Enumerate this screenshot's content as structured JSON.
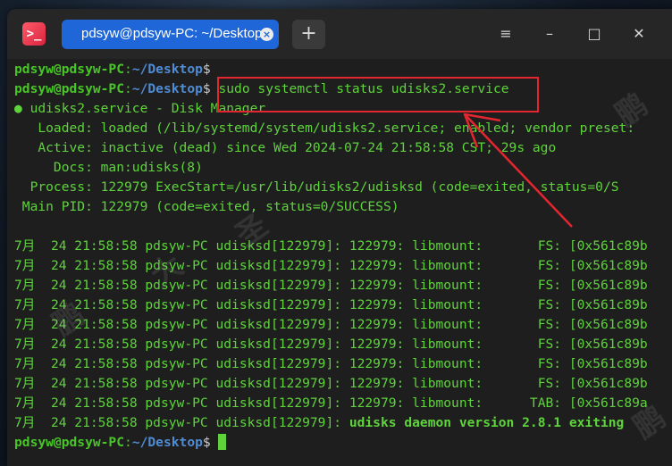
{
  "window": {
    "tab_title": "pdsyw@pdsyw-PC: ~/Desktop",
    "new_tab_symbol": "+",
    "tab_close_symbol": "×",
    "minimize_symbol": "–",
    "maximize_symbol": "□",
    "close_symbol": "✕",
    "menu_symbol": "≡",
    "app_icon_glyph": ">_"
  },
  "prompt": {
    "user": "pdsyw@pdsyw-PC",
    "sep": ":",
    "path": "~/Desktop",
    "dollar": "$"
  },
  "command": "sudo systemctl status udisks2.service",
  "status": {
    "l1": "● udisks2.service - Disk Manager",
    "l2": "   Loaded: loaded (/lib/systemd/system/udisks2.service; enabled; vendor preset:",
    "l3": "   Active: inactive (dead) since Wed 2024-07-24 21:58:58 CST; 29s ago",
    "l4": "     Docs: man:udisks(8)",
    "l5": "  Process: 122979 ExecStart=/usr/lib/udisks2/udisksd (code=exited, status=0/S",
    "l6": " Main PID: 122979 (code=exited, status=0/SUCCESS)"
  },
  "logs": [
    "7月  24 21:58:58 pdsyw-PC udisksd[122979]: 122979: libmount:       FS: [0x561c89b",
    "7月  24 21:58:58 pdsyw-PC udisksd[122979]: 122979: libmount:       FS: [0x561c89b",
    "7月  24 21:58:58 pdsyw-PC udisksd[122979]: 122979: libmount:       FS: [0x561c89b",
    "7月  24 21:58:58 pdsyw-PC udisksd[122979]: 122979: libmount:       FS: [0x561c89b",
    "7月  24 21:58:58 pdsyw-PC udisksd[122979]: 122979: libmount:       FS: [0x561c89b",
    "7月  24 21:58:58 pdsyw-PC udisksd[122979]: 122979: libmount:       FS: [0x561c89b",
    "7月  24 21:58:58 pdsyw-PC udisksd[122979]: 122979: libmount:       FS: [0x561c89b",
    "7月  24 21:58:58 pdsyw-PC udisksd[122979]: 122979: libmount:       FS: [0x561c89b",
    "7月  24 21:58:58 pdsyw-PC udisksd[122979]: 122979: libmount:      TAB: [0x561c89a"
  ],
  "last_log": {
    "prefix": "7月  24 21:58:58 pdsyw-PC udisksd[122979]: ",
    "message": "udisks daemon version 2.8.1 exiting"
  },
  "watermark": [
    "鹏",
    "大",
    "圣"
  ],
  "colors": {
    "terminal_bg": "#1e1e1e",
    "text_green": "#5fd33c",
    "path_blue": "#4f8cd6",
    "tab_blue": "#1f67d8",
    "annotation_red": "#e3262f"
  }
}
